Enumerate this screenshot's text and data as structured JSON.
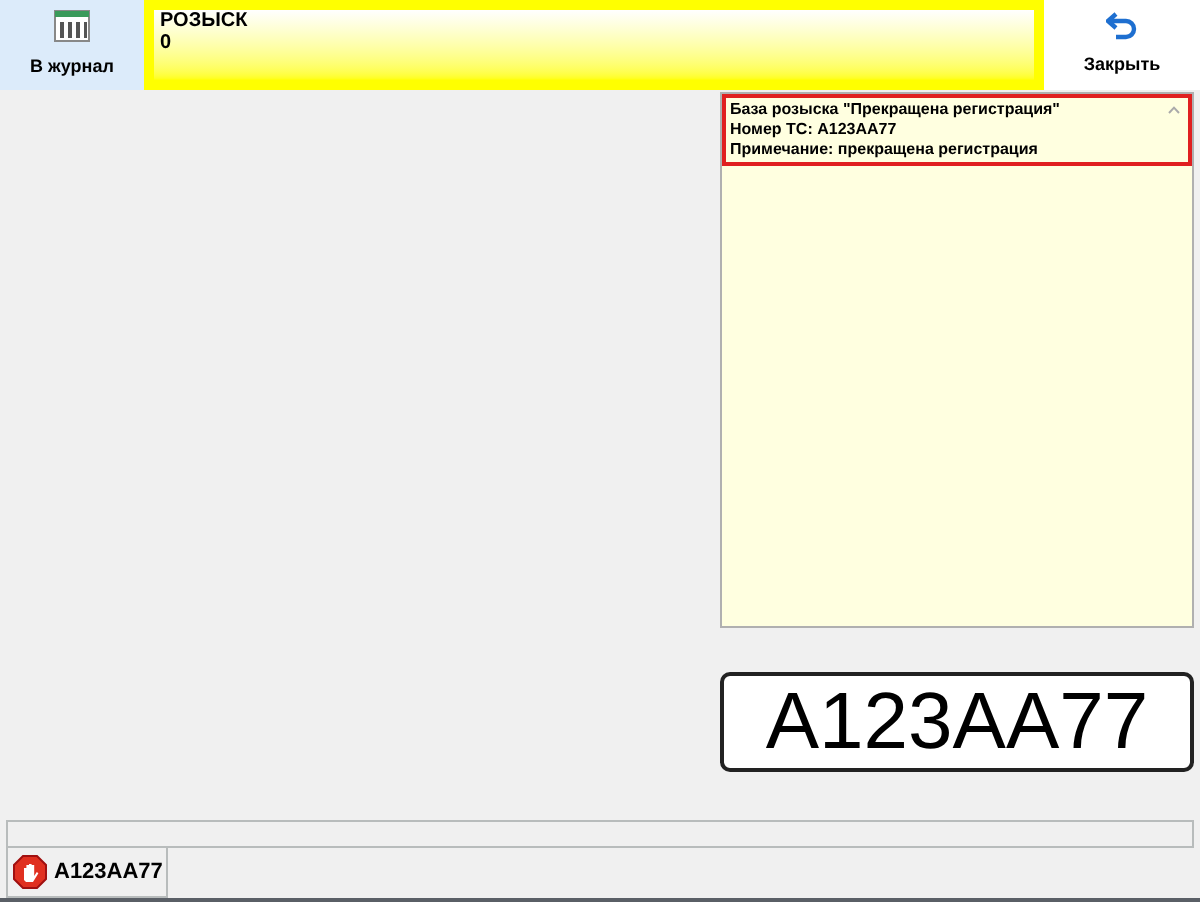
{
  "toolbar": {
    "journal_button": "В журнал",
    "alert": {
      "title": "РОЗЫСК",
      "count": "0"
    },
    "close_button": "Закрыть"
  },
  "details": {
    "lines": [
      "База розыска \"Прекращена регистрация\"",
      "Номер ТС: А123АА77",
      "Примечание: прекращена регистрация"
    ]
  },
  "plate": "А123АА77",
  "tabs": [
    {
      "label": "А123АА77",
      "selected": true
    }
  ]
}
